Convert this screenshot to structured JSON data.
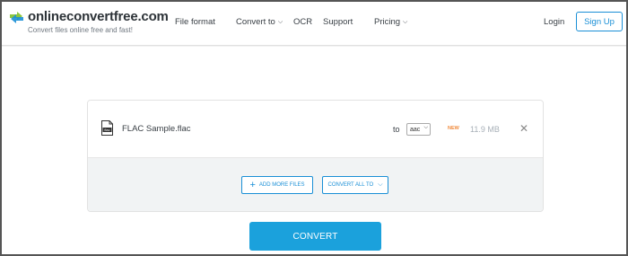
{
  "brand": {
    "name": "onlineconvertfree.com",
    "tagline": "Convert files online free and fast!"
  },
  "nav": {
    "items": [
      {
        "label": "File format",
        "dropdown": false
      },
      {
        "label": "Convert to",
        "dropdown": true
      },
      {
        "label": "OCR",
        "dropdown": false
      },
      {
        "label": "Support",
        "dropdown": false
      },
      {
        "label": "Pricing",
        "dropdown": true
      }
    ],
    "login": "Login",
    "signup": "Sign Up"
  },
  "file": {
    "name": "FLAC Sample.flac",
    "icon": "flac-file-icon",
    "to_label": "to",
    "format": "aac",
    "badge": "NEW",
    "size": "11.9 MB"
  },
  "actions": {
    "add_more": "ADD MORE FILES",
    "convert_all": "CONVERT ALL TO"
  },
  "convert_label": "CONVERT",
  "colors": {
    "accent": "#1a8fd6",
    "convert_button": "#1ba1dc",
    "badge_new": "#f08a3c",
    "logo_green": "#8cc63f",
    "logo_blue": "#1a8fd6"
  }
}
